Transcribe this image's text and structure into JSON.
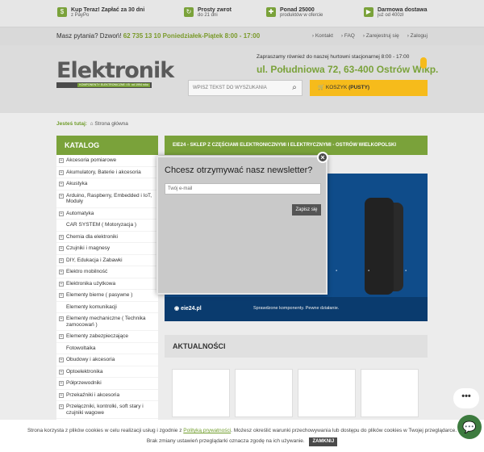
{
  "perks": [
    {
      "icon": "payment-icon",
      "title": "Kup Teraz! Zapłać za 30 dni",
      "subtitle": "z PayPo"
    },
    {
      "icon": "return-icon",
      "title": "Prosty zwrot",
      "subtitle": "do 21 dni"
    },
    {
      "icon": "products-icon",
      "title": "Ponad 25000",
      "subtitle": "produktów w ofercie"
    },
    {
      "icon": "truck-icon",
      "title": "Darmowa dostawa",
      "subtitle": "już od 400zł"
    }
  ],
  "phone": {
    "prefix": "Masz pytania? Dzwoń!",
    "number": "62 735 13 10 Poniedziałek-Piątek 8:00 - 17:00"
  },
  "top_links": [
    "Kontakt",
    "FAQ",
    "Zarejestruj się",
    "Zaloguj"
  ],
  "logo": {
    "name": "Elektronik",
    "tagline": "KOMPONENTY ELEKTRONICZNE I ELEKTRYCZNE",
    "since": "od 1994 roku"
  },
  "search": {
    "placeholder": "WPISZ TEKST DO WYSZUKANIA"
  },
  "warehouse": {
    "note": "Zapraszamy również do naszej hurtowni stacjonarnej 8:00 - 17:00",
    "address": "ul. Południowa 72, 63-400 Ostrów Wlkp."
  },
  "cart": {
    "label": "KOSZYK",
    "state": "(PUSTY)"
  },
  "breadcrumb": {
    "label": "Jesteś tutaj:",
    "home": "Strona główna"
  },
  "sidebar": {
    "title": "KATALOG",
    "items": [
      {
        "label": "Akcesoria pomiarowe",
        "expandable": true
      },
      {
        "label": "Akumulatory, Baterie i akcesoria",
        "expandable": true
      },
      {
        "label": "Akustyka",
        "expandable": true
      },
      {
        "label": "Arduino, Raspberry, Embedded i IoT, Moduły",
        "expandable": true
      },
      {
        "label": "Automatyka",
        "expandable": true
      },
      {
        "label": "CAR SYSTEM ( Motoryzacja )",
        "expandable": false
      },
      {
        "label": "Chemia dla elektroniki",
        "expandable": true
      },
      {
        "label": "Czujniki i magnesy",
        "expandable": true
      },
      {
        "label": "DIY, Edukacja i Zabawki",
        "expandable": true
      },
      {
        "label": "Elektro mobilność",
        "expandable": true
      },
      {
        "label": "Elektronika użytkowa",
        "expandable": true
      },
      {
        "label": "Elementy bierne ( pasywne )",
        "expandable": true
      },
      {
        "label": "Elementy komunikacji",
        "expandable": false
      },
      {
        "label": "Elementy mechaniczne ( Technika zamocowań )",
        "expandable": true
      },
      {
        "label": "Elementy zabezpieczające",
        "expandable": true
      },
      {
        "label": "Fotowoltaika",
        "expandable": false
      },
      {
        "label": "Obudowy i akcesoria",
        "expandable": true
      },
      {
        "label": "Optoelektronika",
        "expandable": true
      },
      {
        "label": "Półprzewodniki",
        "expandable": true
      },
      {
        "label": "Przekaźniki i akcesoria",
        "expandable": true
      },
      {
        "label": "Przełączniki, kontrolki, soft stary i czujniki wagowe",
        "expandable": true
      }
    ]
  },
  "main": {
    "banner_title": "EIE24 - SKLEP Z CZĘŚCIAMI ELEKTRONICZNYMI I ELEKTRYCZNYMI - OSTRÓW WIELKOPOLSKI",
    "banner_brand": "eie24.pl",
    "banner_slogan": "Sprawdzone komponenty. Pewne działanie.",
    "news_title": "AKTUALNOŚCI"
  },
  "newsletter": {
    "title": "Chcesz otrzymywać nasz newsletter?",
    "placeholder": "Twój e-mail",
    "button": "Zapisz się",
    "close": "×"
  },
  "cookie": {
    "text1": "Strona korzysta z plików cookies w celu realizacji usług i zgodnie z",
    "link": "Polityką prywatności",
    "text2": ". Możesz określić warunki przechowywania lub dostępu do plików cookies w Twojej przeglądarce.",
    "text3": "Brak zmiany ustawień przeglądarki oznacza zgodę na ich używanie.",
    "button": "ZAMKNIJ"
  },
  "colors": {
    "accent": "#7aa23a",
    "cart": "#f6bb1b",
    "banner": "#0f4c8a"
  }
}
